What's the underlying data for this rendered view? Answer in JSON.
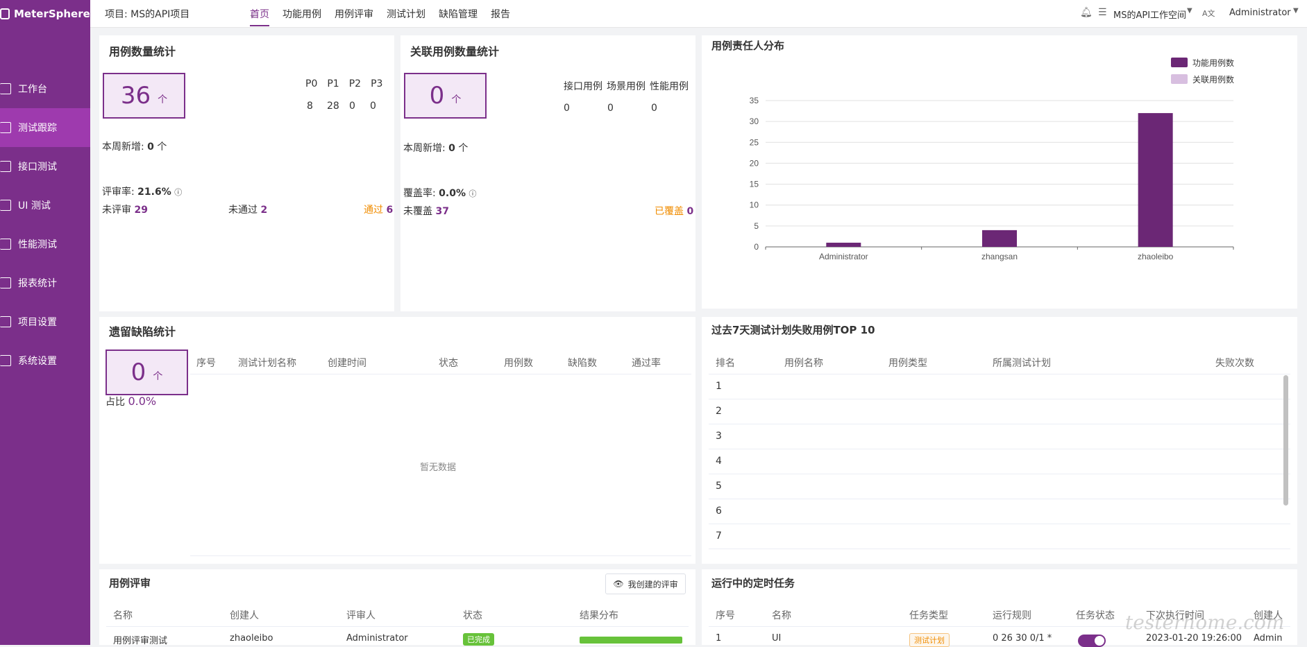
{
  "app": {
    "name": "MeterSphere"
  },
  "topbar": {
    "project": "项目: MS的API项目",
    "nav": [
      "首页",
      "功能用例",
      "用例评审",
      "测试计划",
      "缺陷管理",
      "报告"
    ],
    "workspace": "MS的API工作空间",
    "user": "Administrator"
  },
  "sidebar": {
    "items": [
      "工作台",
      "测试跟踪",
      "接口测试",
      "UI 测试",
      "性能测试",
      "报表统计",
      "项目设置",
      "系统设置"
    ]
  },
  "case_count": {
    "title": "用例数量统计",
    "total": "36",
    "unit": "个",
    "priorities": [
      "P0",
      "P1",
      "P2",
      "P3"
    ],
    "priority_values": [
      "8",
      "28",
      "0",
      "0"
    ],
    "week_new_label": "本周新增:",
    "week_new": "0",
    "review_rate_label": "评审率:",
    "review_rate": "21.6%",
    "not_reviewed_label": "未评审",
    "not_reviewed": "29",
    "not_passed_label": "未通过",
    "not_passed": "2",
    "passed_label": "通过",
    "passed": "6"
  },
  "related_count": {
    "title": "关联用例数量统计",
    "total": "0",
    "unit": "个",
    "types": [
      "接口用例",
      "场景用例",
      "性能用例"
    ],
    "type_values": [
      "0",
      "0",
      "0"
    ],
    "week_new_label": "本周新增:",
    "week_new": "0",
    "coverage_label": "覆盖率:",
    "coverage": "0.0%",
    "uncovered_label": "未覆盖",
    "uncovered": "37",
    "covered_label": "已覆盖",
    "covered": "0"
  },
  "owner_chart": {
    "title": "用例责任人分布"
  },
  "chart_data": {
    "type": "bar",
    "categories": [
      "Administrator",
      "zhangsan",
      "zhaoleibo"
    ],
    "series": [
      {
        "name": "功能用例数",
        "values": [
          1,
          4,
          32
        ],
        "color": "#6b2775"
      },
      {
        "name": "关联用例数",
        "values": [
          0,
          0,
          0
        ],
        "color": "#d8bfe0"
      }
    ],
    "yticks": [
      "0",
      "5",
      "10",
      "15",
      "20",
      "25",
      "30",
      "35"
    ],
    "ylim": [
      0,
      35
    ],
    "grid": true,
    "legend": "top-right"
  },
  "defects": {
    "title": "遗留缺陷统计",
    "total": "0",
    "unit": "个",
    "ratio_label": "占比",
    "ratio": "0.0%",
    "columns": [
      "序号",
      "测试计划名称",
      "创建时间",
      "状态",
      "用例数",
      "缺陷数",
      "通过率"
    ],
    "empty": "暂无数据"
  },
  "top10": {
    "title": "过去7天测试计划失败用例TOP 10",
    "columns": [
      "排名",
      "用例名称",
      "用例类型",
      "所属测试计划",
      "失败次数"
    ],
    "ranks": [
      "1",
      "2",
      "3",
      "4",
      "5",
      "6",
      "7"
    ]
  },
  "review": {
    "title": "用例评审",
    "my_button": "我创建的评审",
    "columns": [
      "名称",
      "创建人",
      "评审人",
      "状态",
      "结果分布"
    ],
    "row": {
      "name": "用例评审测试",
      "creator": "zhaoleibo",
      "reviewer": "Administrator",
      "status": "已完成"
    }
  },
  "schedule": {
    "title": "运行中的定时任务",
    "columns": [
      "序号",
      "名称",
      "任务类型",
      "运行规则",
      "任务状态",
      "下次执行时间",
      "创建人"
    ],
    "row": {
      "no": "1",
      "name": "UI",
      "type": "测试计划",
      "rule": "0 26 30 0/1 *",
      "next": "2023-01-20 19:26:00",
      "creator": "Admin"
    }
  },
  "watermark": "testerhome.com"
}
